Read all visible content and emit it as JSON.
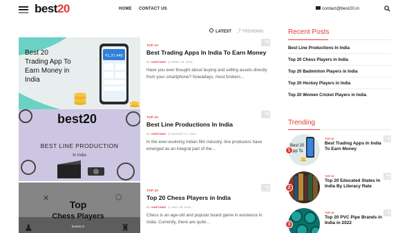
{
  "header": {
    "logo_text": "best",
    "logo_number": "20",
    "nav": [
      "HOME",
      "CONTACT US"
    ],
    "email": "contact@best20.in"
  },
  "tabs": {
    "latest": "LATEST",
    "trending": "TRENDING"
  },
  "posts": [
    {
      "image_text": [
        "Best 20",
        "Trading App To",
        "Earn Money in",
        "India"
      ],
      "category": "TOP 20",
      "title": "Best Trading Apps In India To Earn Money",
      "author": "SWETABH",
      "date": "APRIL 15, 2023",
      "excerpt": "Have you ever thought about buying and selling assets directly from your smartphone? Nowadays, most brokers..."
    },
    {
      "image_logo": "best20",
      "image_text": [
        "BEST LINE PRODUCTION",
        "In India"
      ],
      "category": "TOP 20",
      "title": "Best Line Productions In India",
      "author": "SWETABH",
      "date": "AUGUST 17, 2022",
      "excerpt": "In the ever-evolving Indian film industry, line producers have emerged as an integral part of the..."
    },
    {
      "image_text": [
        "Top",
        "Chess Players"
      ],
      "image_footer": "best20.in",
      "category": "TOP 20",
      "title": "Top 20 Chess Players in India",
      "author": "SWETABH",
      "date": "JULY 25, 2022",
      "excerpt": "Chess is an age-old and popular board game in existence in India. Currently, there are quite..."
    }
  ],
  "sidebar": {
    "recent_title": "Recent Posts",
    "recent": [
      "Best Line Productions In India",
      "Top 20 Chess Players in India",
      "Top 20 Badminton Players in India",
      "Top 20 Hockey Players in India",
      "Top 20 Women Cricket Players in India"
    ],
    "trending_title": "Trending",
    "trending": [
      {
        "num": "1",
        "category": "TOP 20",
        "title": "Best Trading Apps In India To Earn Money"
      },
      {
        "num": "2",
        "category": "TOP 20",
        "title": "Top 20 Educated States In India By Literacy Rate"
      },
      {
        "num": "3",
        "category": "TOP 20",
        "title": "Top 20 PVC Pipe Brands in India in 2022"
      }
    ]
  },
  "colors": {
    "accent": "#e53935"
  }
}
